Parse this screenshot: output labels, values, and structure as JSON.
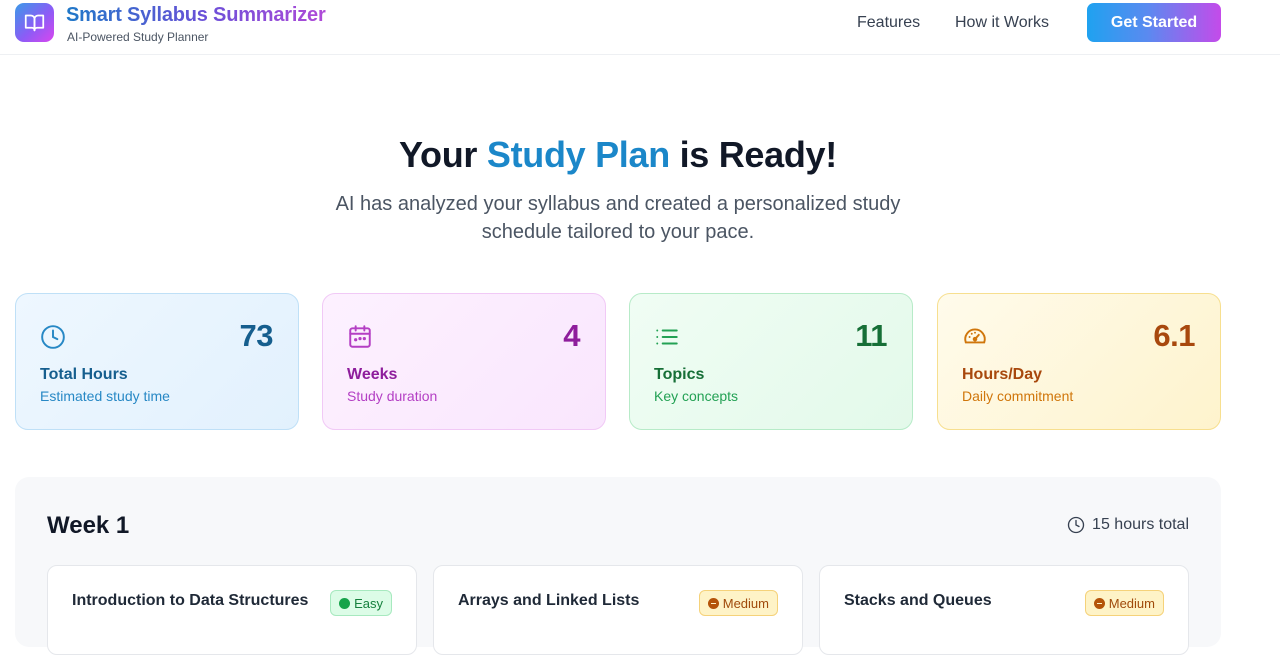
{
  "header": {
    "app_title": "Smart Syllabus Summarizer",
    "app_subtitle": "AI-Powered Study Planner",
    "logo_icon": "book-open-icon",
    "nav": [
      {
        "label": "Features"
      },
      {
        "label": "How it Works"
      }
    ],
    "cta_label": "Get Started"
  },
  "hero": {
    "title_before": "Your ",
    "title_highlight": "Study Plan",
    "title_after": " is Ready!",
    "subtitle": "AI has analyzed your syllabus and created a personalized study schedule tailored to your pace."
  },
  "stats": [
    {
      "icon": "clock-icon",
      "value": "73",
      "label": "Total Hours",
      "description": "Estimated study time",
      "accent": "#155e8e"
    },
    {
      "icon": "calendar-icon",
      "value": "4",
      "label": "Weeks",
      "description": "Study duration",
      "accent": "#8e1d9c"
    },
    {
      "icon": "list-icon",
      "value": "11",
      "label": "Topics",
      "description": "Key concepts",
      "accent": "#166f37"
    },
    {
      "icon": "gauge-icon",
      "value": "6.1",
      "label": "Hours/Day",
      "description": "Daily commitment",
      "accent": "#a8480d"
    }
  ],
  "week": {
    "title": "Week 1",
    "total": "15 hours total",
    "topics": [
      {
        "title": "Introduction to Data Structures",
        "difficulty": "Easy"
      },
      {
        "title": "Arrays and Linked Lists",
        "difficulty": "Medium"
      },
      {
        "title": "Stacks and Queues",
        "difficulty": "Medium"
      }
    ]
  },
  "colors": {
    "brand_blue": "#1b87c9",
    "brand_purple": "#8b5cf6",
    "easy_green": "#16a34a",
    "medium_amber": "#b45309"
  }
}
